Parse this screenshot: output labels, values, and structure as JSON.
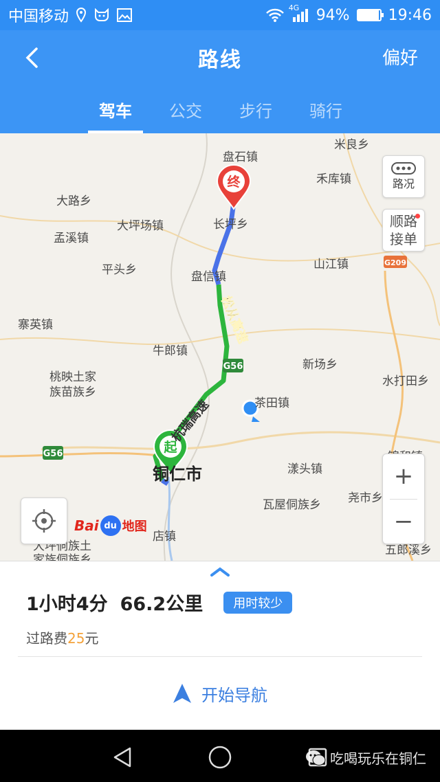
{
  "status_bar": {
    "carrier": "中国移动",
    "network": "4G",
    "battery": "94%",
    "battery_level": 0.94,
    "time": "19:46"
  },
  "header": {
    "title": "路线",
    "preference": "偏好",
    "tabs": [
      {
        "label": "驾车",
        "active": true
      },
      {
        "label": "公交",
        "active": false
      },
      {
        "label": "步行",
        "active": false
      },
      {
        "label": "骑行",
        "active": false
      }
    ]
  },
  "map": {
    "places": [
      {
        "label": "盘石镇"
      },
      {
        "label": "米良乡"
      },
      {
        "label": "禾库镇"
      },
      {
        "label": "大路乡"
      },
      {
        "label": "长坪乡"
      },
      {
        "label": "大坪场镇"
      },
      {
        "label": "孟溪镇"
      },
      {
        "label": "平头乡"
      },
      {
        "label": "山江镇"
      },
      {
        "label": "盘信镇"
      },
      {
        "label": "寨英镇"
      },
      {
        "label": "牛郎镇"
      },
      {
        "label": "新场乡"
      },
      {
        "label": "桃映土家"
      },
      {
        "label": "族苗族乡"
      },
      {
        "label": "水打田乡"
      },
      {
        "label": "茶田镇"
      },
      {
        "label": "铜仁市"
      },
      {
        "label": "漾头镇"
      },
      {
        "label": "瓦屋侗族乡"
      },
      {
        "label": "尧市乡"
      },
      {
        "label": "店镇"
      },
      {
        "label": "五郎溪乡"
      },
      {
        "label": "大坪侗族土"
      },
      {
        "label": "家族侗族乡"
      },
      {
        "label": "锦和镇"
      }
    ],
    "road_labels": {
      "song_expressway": "松从高速",
      "g56": "G56",
      "g209": "G209",
      "other_expressway": "杭瑞高速"
    },
    "markers": {
      "start": "起",
      "end": "终"
    },
    "traffic_label": "路况",
    "shunlu_label_1": "顺路",
    "shunlu_label_2": "接单",
    "zoom_in": "+",
    "zoom_out": "−",
    "logo": {
      "bai": "Bai",
      "du": "du",
      "ditu": "地图"
    }
  },
  "panel": {
    "duration": "1小时4分",
    "distance": "66.2公里",
    "tag": "用时较少",
    "toll_prefix": "过路费",
    "toll_amount": "25",
    "toll_suffix": "元",
    "start_nav": "开始导航"
  },
  "watermark": "吃喝玩乐在铜仁",
  "colors": {
    "header_blue": "#3c95f5",
    "route_green": "#2db53d",
    "route_blue": "#4a72e8",
    "end_red": "#e8413a",
    "toll_orange": "#f4a23a"
  }
}
